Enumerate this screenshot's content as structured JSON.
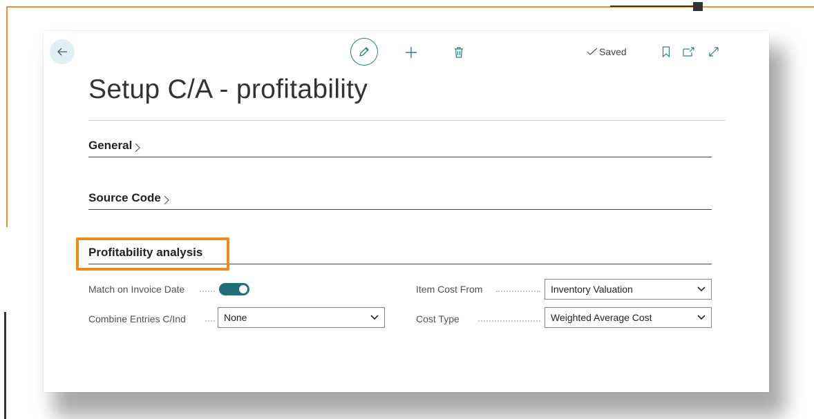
{
  "toolbar": {
    "saved_label": "Saved",
    "icons": [
      "back-arrow-icon",
      "edit-pencil-icon",
      "plus-icon",
      "trash-icon",
      "check-icon",
      "bookmark-icon",
      "open-in-new-icon",
      "expand-icon"
    ]
  },
  "page": {
    "title": "Setup C/A - profitability"
  },
  "sections": {
    "general": "General",
    "source_code": "Source Code",
    "profitability": "Profitability analysis"
  },
  "fields": {
    "match_on_invoice_date": {
      "label": "Match on Invoice Date",
      "value": true
    },
    "combine_entries": {
      "label": "Combine Entries C/Ind",
      "value": "None"
    },
    "item_cost_from": {
      "label": "Item Cost From",
      "value": "Inventory Valuation"
    },
    "cost_type": {
      "label": "Cost Type",
      "value": "Weighted Average Cost"
    }
  },
  "colors": {
    "highlight": "#ec8c1a",
    "accent": "#1f6f7a",
    "frame": "#e8933a"
  }
}
